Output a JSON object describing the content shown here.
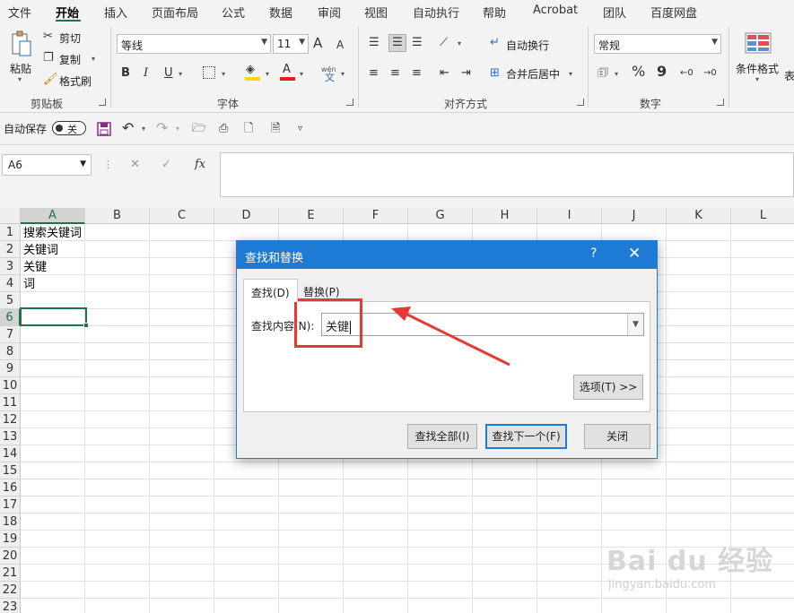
{
  "menu_tabs": [
    "文件",
    "开始",
    "插入",
    "页面布局",
    "公式",
    "数据",
    "审阅",
    "视图",
    "自动执行",
    "帮助",
    "Acrobat",
    "团队",
    "百度网盘"
  ],
  "ribbon": {
    "clipboard": {
      "paste": "粘贴",
      "cut": "剪切",
      "copy": "复制",
      "format_painter": "格式刷",
      "label": "剪贴板"
    },
    "font": {
      "name": "等线",
      "size": "11",
      "bold": "B",
      "italic": "I",
      "underline": "U",
      "grow": "A",
      "shrink": "A",
      "font_color": "A",
      "phonetic": "wén",
      "label": "字体",
      "highlight_color": "#f5d90a",
      "text_color": "#e12020"
    },
    "alignment": {
      "wrap_text": "自动换行",
      "merge_center": "合并后居中",
      "label": "对齐方式"
    },
    "number": {
      "format": "常规",
      "percent": "%",
      "comma": "9",
      "label": "数字"
    },
    "styles": {
      "conditional": "条件格式",
      "table_partial": "表"
    }
  },
  "qat": {
    "autosave_label": "自动保存",
    "autosave_state": "关"
  },
  "formula_bar": {
    "name_box": "A6",
    "cancel": "✕",
    "enter": "✓",
    "fx": "fx",
    "value": ""
  },
  "sheet": {
    "columns": [
      "A",
      "B",
      "C",
      "D",
      "E",
      "F",
      "G",
      "H",
      "I",
      "J",
      "K",
      "L"
    ],
    "rows": [
      "1",
      "2",
      "3",
      "4",
      "5",
      "6",
      "7",
      "8",
      "9",
      "10",
      "11",
      "12",
      "13",
      "14",
      "15",
      "16",
      "17",
      "18",
      "19",
      "20",
      "21",
      "22",
      "23"
    ],
    "cells": {
      "A1": "搜索关键词",
      "A2": "关键词",
      "A3": "关键",
      "A4": "词"
    },
    "active_cell": "A6"
  },
  "dialog": {
    "title": "查找和替换",
    "help": "?",
    "close": "✕",
    "tab_find": "查找(D)",
    "tab_replace": "替换(P)",
    "find_label": "查找内容(N):",
    "find_value": "关键",
    "options_button": "选项(T) >>",
    "find_all": "查找全部(I)",
    "find_next": "查找下一个(F)",
    "close_button": "关闭"
  },
  "colors": {
    "accent": "#217346",
    "dialog_title": "#1d7bd5",
    "annotation": "#e53935"
  },
  "watermark": {
    "logo": "Bai du 经验",
    "url": "jingyan.baidu.com"
  }
}
